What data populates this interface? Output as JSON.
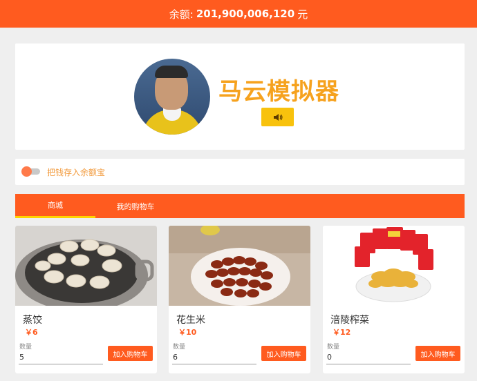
{
  "header": {
    "balance_label": "余额:",
    "balance_amount": "201,900,006,120",
    "currency": "元"
  },
  "hero": {
    "title": "马云模拟器",
    "sound_icon": "speaker-icon"
  },
  "savings_toggle": {
    "label": "把钱存入余额宝",
    "on": false
  },
  "tabs": [
    {
      "label": "商城",
      "active": true
    },
    {
      "label": "我的购物车",
      "active": false
    }
  ],
  "products": [
    {
      "name": "蒸饺",
      "price": "￥6",
      "qty_label": "数量",
      "qty": "5",
      "button": "加入购物车"
    },
    {
      "name": "花生米",
      "price": "￥10",
      "qty_label": "数量",
      "qty": "6",
      "button": "加入购物车"
    },
    {
      "name": "涪陵榨菜",
      "price": "￥12",
      "qty_label": "数量",
      "qty": "0",
      "button": "加入购物车"
    }
  ],
  "colors": {
    "brand": "#ff5b1f",
    "title": "#f6a21e",
    "sound_button": "#f8c20d",
    "tab_indicator": "#ffd400"
  }
}
